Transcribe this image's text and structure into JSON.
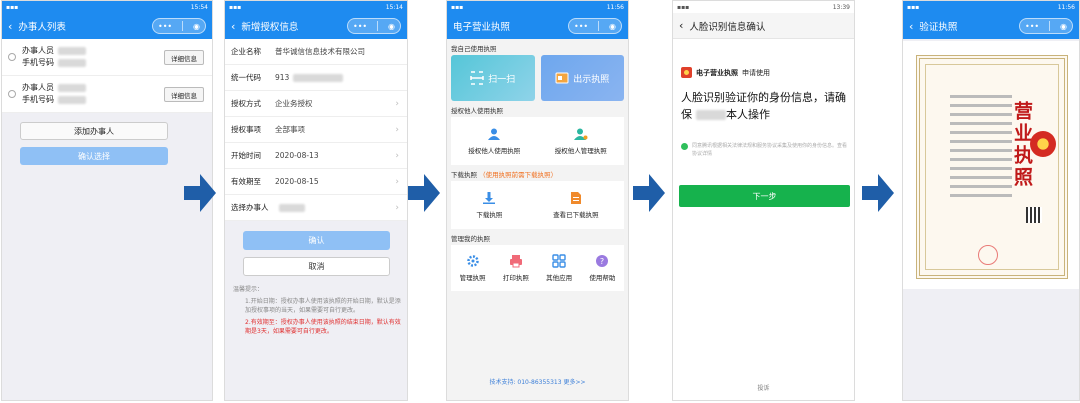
{
  "colors": {
    "primary": "#1e8bf0",
    "confirm_disabled": "#8fc0f5",
    "green": "#16b24d",
    "arrow": "#1f5ea8",
    "red": "#e03030"
  },
  "p1": {
    "status_time": "15:54",
    "title": "办事人列表",
    "items": [
      {
        "name_label": "办事人员",
        "phone_label": "手机号码",
        "detail": "详细信息"
      },
      {
        "name_label": "办事人员",
        "phone_label": "手机号码",
        "detail": "详细信息"
      }
    ],
    "add_button": "添加办事人",
    "confirm_button": "确认选择"
  },
  "p2": {
    "status_time": "15:14",
    "title": "新增授权信息",
    "rows": [
      {
        "label": "企业名称",
        "value": "普华诚信信息技术有限公司"
      },
      {
        "label": "统一代码",
        "value": "913"
      },
      {
        "label": "授权方式",
        "value": "企业务授权"
      },
      {
        "label": "授权事项",
        "value": "全部事项"
      },
      {
        "label": "开始时间",
        "value": "2020-08-13"
      },
      {
        "label": "有效期至",
        "value": "2020-08-15"
      },
      {
        "label": "选择办事人",
        "value": ""
      }
    ],
    "confirm": "确认",
    "cancel": "取消",
    "tips_title": "温馨提示：",
    "tip1": "1.开始日期：授权办事人使用该执照的开始日期，默认是添加授权事项的当天，如果需要可自行更改。",
    "tip2": "2.有效期至：授权办事人使用该执照的结束日期，默认有效期是3天，如果需要可自行更改。"
  },
  "p3": {
    "status_time": "11:56",
    "title": "电子营业执照",
    "sec_own": "我自己使用执照",
    "scan": "扫一扫",
    "show": "出示执照",
    "sec_auth": "授权他人使用执照",
    "auth_use": "授权他人使用执照",
    "auth_manage": "授权他人管理执照",
    "sec_download": "下载执照",
    "sec_download_note": "（使用执照前需下载执照）",
    "download": "下载执照",
    "view_downloaded": "查看已下载执照",
    "sec_manage": "管理我的执照",
    "manage": "管理执照",
    "print": "打印执照",
    "other": "其他应用",
    "help": "使用帮助",
    "footer": "技术支持: 010-86355313  更多>>"
  },
  "p4": {
    "status_time": "13:39",
    "title": "人脸识别信息确认",
    "brand": "电子营业执照",
    "brand_suffix": "申请使用",
    "headline_a": "人脸识别验证你的身份信息，请确保",
    "headline_b": "本人操作",
    "agree": "同意腾讯根据相关法律法规和服务协议采集及使用你的身份信息。查看协议详情",
    "next": "下一步",
    "feedback": "投诉"
  },
  "p5": {
    "status_time": "11:56",
    "title": "验证执照",
    "license_title": "营业执照"
  }
}
